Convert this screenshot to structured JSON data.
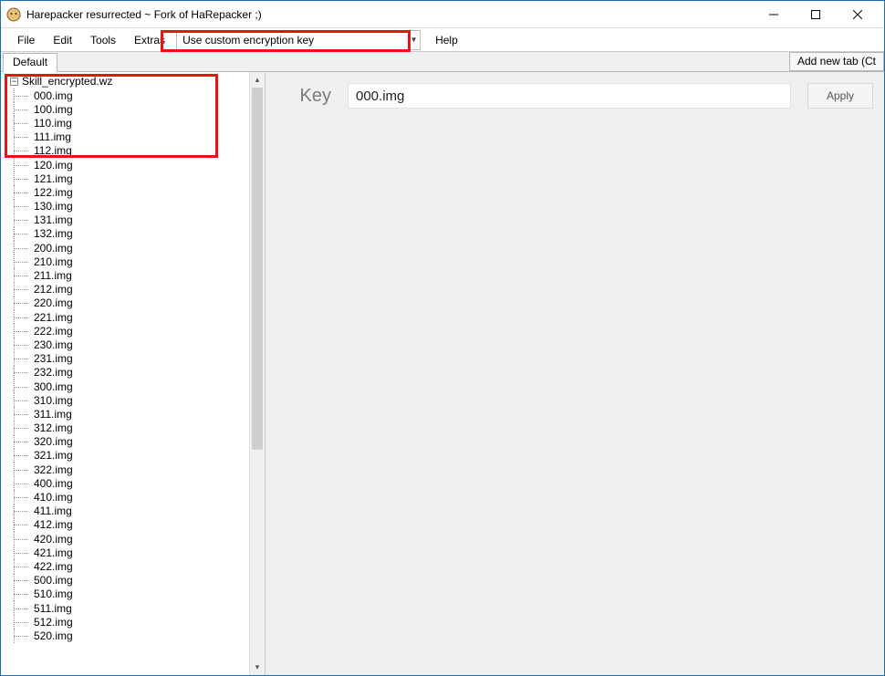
{
  "window": {
    "title": "Harepacker resurrected ~ Fork of HaRepacker ;)"
  },
  "menu": {
    "file": "File",
    "edit": "Edit",
    "tools": "Tools",
    "extras": "Extras",
    "help": "Help",
    "encryption_dropdown": "Use custom encryption key"
  },
  "tabs": {
    "active": "Default",
    "add_button": "Add new tab (Ct"
  },
  "tree": {
    "root": "Skill_encrypted.wz",
    "items": [
      "000.img",
      "100.img",
      "110.img",
      "111.img",
      "112.img",
      "120.img",
      "121.img",
      "122.img",
      "130.img",
      "131.img",
      "132.img",
      "200.img",
      "210.img",
      "211.img",
      "212.img",
      "220.img",
      "221.img",
      "222.img",
      "230.img",
      "231.img",
      "232.img",
      "300.img",
      "310.img",
      "311.img",
      "312.img",
      "320.img",
      "321.img",
      "322.img",
      "400.img",
      "410.img",
      "411.img",
      "412.img",
      "420.img",
      "421.img",
      "422.img",
      "500.img",
      "510.img",
      "511.img",
      "512.img",
      "520.img"
    ]
  },
  "detail": {
    "key_label": "Key",
    "key_value": "000.img",
    "apply": "Apply"
  }
}
